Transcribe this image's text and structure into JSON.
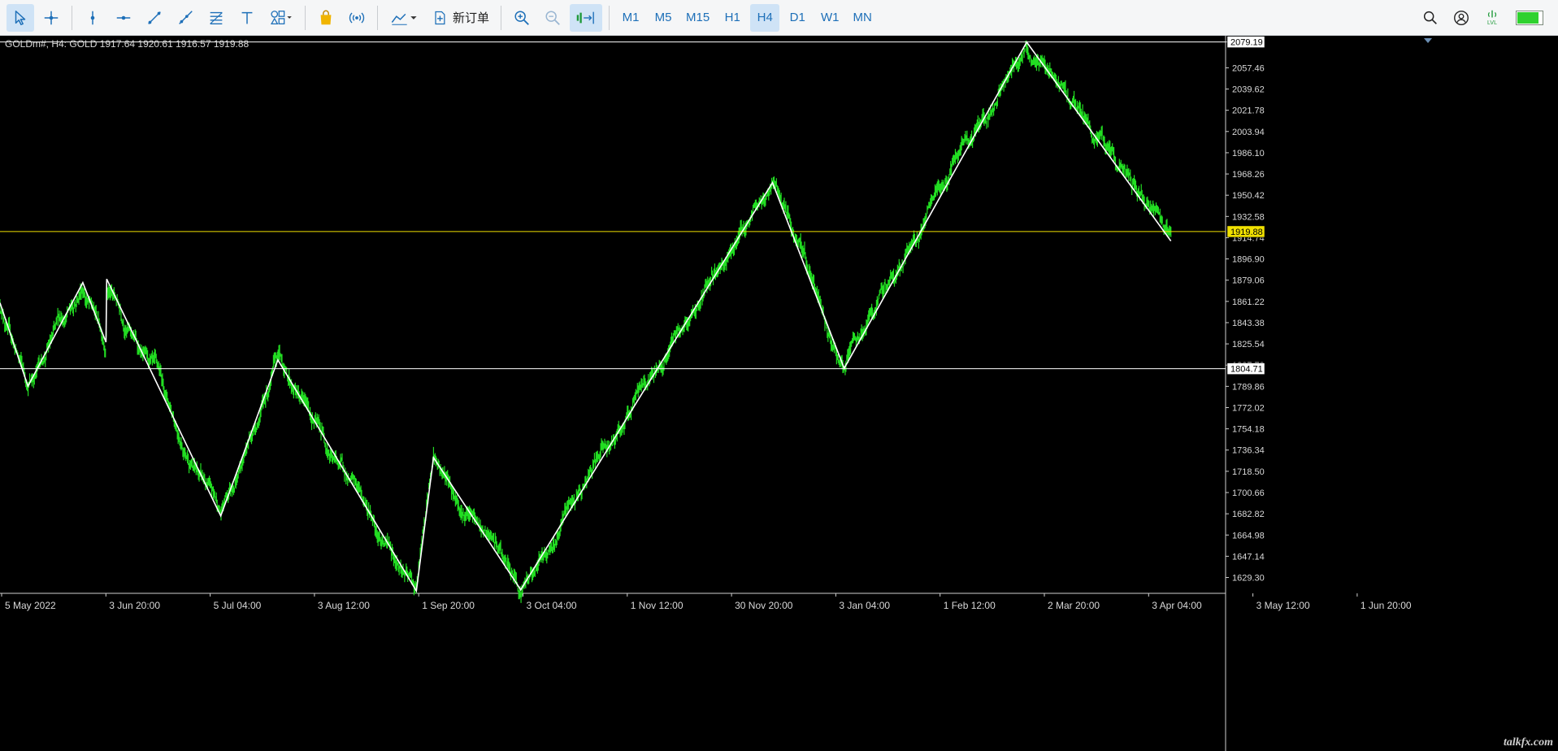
{
  "toolbar": {
    "tools": [
      {
        "name": "cursor-tool",
        "icon": "cursor-arrow-icon",
        "active": true
      },
      {
        "name": "crosshair-tool",
        "icon": "crosshair-icon"
      },
      {
        "name": "vertical-line-tool",
        "icon": "vertical-line-icon"
      },
      {
        "name": "horizontal-line-tool",
        "icon": "horizontal-line-icon"
      },
      {
        "name": "trend-line-tool",
        "icon": "trend-line-icon"
      },
      {
        "name": "ray-tool",
        "icon": "ray-icon"
      },
      {
        "name": "fibonacci-tool",
        "icon": "fibonacci-icon"
      },
      {
        "name": "text-tool",
        "icon": "text-icon"
      },
      {
        "name": "shapes-tool",
        "icon": "shapes-icon"
      }
    ],
    "new_order_label": "新订单",
    "timeframes": [
      "M1",
      "M5",
      "M15",
      "H1",
      "H4",
      "D1",
      "W1",
      "MN"
    ],
    "active_timeframe": "H4",
    "level_fill": 0.8,
    "level_label": "LVL"
  },
  "chart": {
    "info": "GOLDm#, H4:  GOLD  1917.64 1920.61 1916.57 1919.88",
    "watermark": "talkfx.com",
    "colors": {
      "background": "#000000",
      "candles": "#22dd22",
      "zigzag": "#ffffff",
      "bid_line": "#f0e000",
      "level_line": "#ffffff",
      "axis_text": "#d8d8d8"
    }
  },
  "chart_data": {
    "type": "line",
    "symbol": "GOLDm#",
    "timeframe": "H4",
    "ohlc": {
      "open": 1917.64,
      "high": 1920.61,
      "low": 1916.57,
      "close": 1919.88
    },
    "ylim": [
      1616,
      2083
    ],
    "y_ticks": [
      2079.19,
      2057.46,
      2039.62,
      2021.78,
      2003.94,
      1986.1,
      1968.26,
      1950.42,
      1932.58,
      1914.74,
      1896.9,
      1879.06,
      1861.22,
      1843.38,
      1825.54,
      1807.7,
      1789.86,
      1772.02,
      1754.18,
      1736.34,
      1718.5,
      1700.66,
      1682.82,
      1664.98,
      1647.14,
      1629.3
    ],
    "x_ticks": [
      "5 May 2022",
      "3 Jun 20:00",
      "5 Jul 04:00",
      "3 Aug 12:00",
      "1 Sep 20:00",
      "3 Oct 04:00",
      "1 Nov 12:00",
      "30 Nov 20:00",
      "3 Jan 04:00",
      "1 Feb 12:00",
      "2 Mar 20:00",
      "3 Apr 04:00",
      "3 May 12:00",
      "1 Jun 20:00"
    ],
    "price_labels": [
      {
        "label": "2079.19",
        "value": 2079.19,
        "style": "boxed"
      },
      {
        "label": "1919.88",
        "value": 1919.88,
        "style": "bid"
      },
      {
        "label": "1804.71",
        "value": 1804.71,
        "style": "boxed"
      }
    ],
    "horizontal_lines": [
      {
        "name": "bid-line",
        "value": 1919.88,
        "color": "#f0e000"
      },
      {
        "name": "level-line",
        "value": 1804.71,
        "color": "#ffffff"
      },
      {
        "name": "top-line",
        "value": 2079.19,
        "color": "#ffffff"
      }
    ],
    "zigzag": [
      {
        "t": 0.0,
        "price": 1860
      },
      {
        "t": 0.0228,
        "price": 1790
      },
      {
        "t": 0.0676,
        "price": 1877
      },
      {
        "t": 0.0865,
        "price": 1827
      },
      {
        "t": 0.0871,
        "price": 1880
      },
      {
        "t": 0.1801,
        "price": 1681
      },
      {
        "t": 0.2267,
        "price": 1812
      },
      {
        "t": 0.3397,
        "price": 1618
      },
      {
        "t": 0.3537,
        "price": 1730
      },
      {
        "t": 0.4249,
        "price": 1619
      },
      {
        "t": 0.6303,
        "price": 1961
      },
      {
        "t": 0.6888,
        "price": 1805
      },
      {
        "t": 0.8377,
        "price": 2079
      },
      {
        "t": 0.9554,
        "price": 1912
      }
    ]
  }
}
